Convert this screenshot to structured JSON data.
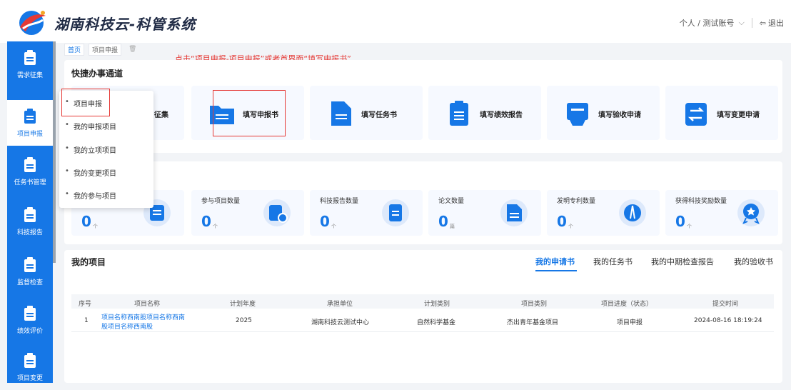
{
  "header": {
    "app_title": "湖南科技云-科管系统",
    "user_label": "个人 / 测试账号",
    "logout_label": "退出"
  },
  "sidebar": {
    "items": [
      {
        "label": "需求征集",
        "active": false
      },
      {
        "label": "项目申报",
        "active": true
      },
      {
        "label": "任务书管理",
        "active": false
      },
      {
        "label": "科技报告",
        "active": false
      },
      {
        "label": "监督检查",
        "active": false
      },
      {
        "label": "绩效评价",
        "active": false
      },
      {
        "label": "项目变更",
        "active": false
      }
    ]
  },
  "tabs": [
    {
      "label": "首页"
    },
    {
      "label": "项目申报"
    }
  ],
  "annotation": "点击“项目申报-项目申报”或者首界面“填写申报书”",
  "quick": {
    "title": "快捷办事通道",
    "cards": [
      {
        "label": "征集"
      },
      {
        "label": "填写申报书"
      },
      {
        "label": "填写任务书"
      },
      {
        "label": "填写绩效报告"
      },
      {
        "label": "填写验收申请"
      },
      {
        "label": "填写变更申请"
      }
    ]
  },
  "dropdown": {
    "items": [
      {
        "label": "项目申报"
      },
      {
        "label": "我的申报项目"
      },
      {
        "label": "我的立项项目"
      },
      {
        "label": "我的变更项目"
      },
      {
        "label": "我的参与项目"
      }
    ]
  },
  "stats": [
    {
      "label": "",
      "value": "0",
      "unit": "个"
    },
    {
      "label": "参与项目数量",
      "value": "0",
      "unit": "个"
    },
    {
      "label": "科技报告数量",
      "value": "0",
      "unit": "个"
    },
    {
      "label": "论文数量",
      "value": "0",
      "unit": "篇"
    },
    {
      "label": "发明专利数量",
      "value": "0",
      "unit": "个"
    },
    {
      "label": "获得科技奖励数量",
      "value": "0",
      "unit": "个"
    }
  ],
  "projects": {
    "title": "我的项目",
    "tabs": [
      {
        "label": "我的申请书"
      },
      {
        "label": "我的任务书"
      },
      {
        "label": "我的中期检查报告"
      },
      {
        "label": "我的验收书"
      }
    ],
    "columns": [
      "序号",
      "项目名称",
      "计划年度",
      "承担单位",
      "计划类别",
      "项目类别",
      "项目进度（状态）",
      "提交时间"
    ],
    "rows": [
      {
        "index": "1",
        "name_line1": "项目名称西南股项目名称西南",
        "name_line2": "股项目名称西南股",
        "year": "2025",
        "unit": "湖南科技云测试中心",
        "plan": "自然科学基金",
        "category": "杰出青年基金项目",
        "status": "项目申报",
        "time": "2024-08-16 18:19:24"
      }
    ]
  },
  "colors": {
    "primary": "#1677e6",
    "annotation": "#e53935"
  }
}
